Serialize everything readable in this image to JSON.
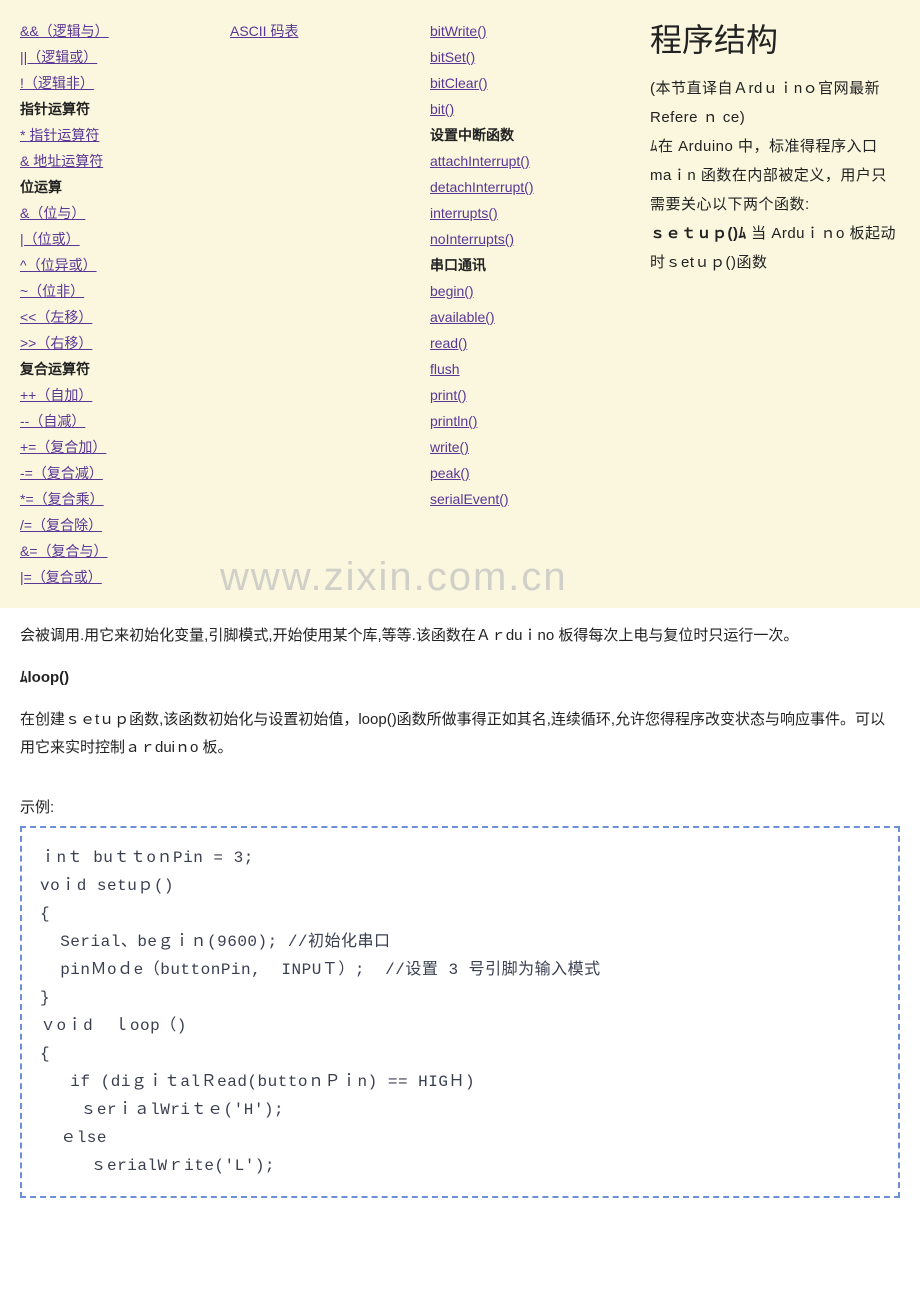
{
  "col1": {
    "links_a": [
      "&&（逻辑与）",
      "||（逻辑或）",
      " !（逻辑非）"
    ],
    "hdr_ptr": "指针运算符",
    "links_ptr": [
      "* 指针运算符",
      "& 地址运算符"
    ],
    "hdr_bit": "位运算",
    "links_bit": [
      "&（位与）",
      "|（位或）",
      "^（位异或）",
      "~（位非）",
      "<<（左移）",
      ">>（右移）"
    ],
    "hdr_cmp": "复合运算符",
    "links_cmp": [
      "++（自加）",
      "--（自减）",
      "+=（复合加）",
      "-=（复合减）",
      "*=（复合乘）",
      "/=（复合除）",
      "&=（复合与）",
      "|=（复合或）"
    ]
  },
  "col2": {
    "link_ascii": "ASCII 码表"
  },
  "col3": {
    "links_top": [
      "bitWrite()",
      "bitSet()",
      "bitClear()",
      "bit()"
    ],
    "hdr_int": "设置中断函数",
    "links_int": [
      "attachInterrupt()",
      "detachInterrupt()",
      "interrupts()",
      "noInterrupts()"
    ],
    "hdr_ser": "串口通讯",
    "links_ser": [
      "begin()",
      "available()",
      "read()",
      "flush",
      "print()",
      "println()",
      "write()",
      "peak()",
      "serialEvent()"
    ]
  },
  "side": {
    "title": "程序结构",
    "p1": "(本节直译自Ａrdｕｉnｏ官网最新Refere ｎ ce)",
    "p2": "ﾑ在 Arduino 中，标准得程序入口 maｉn 函数在内部被定义，用户只需要关心以下两个函数:",
    "p3_label": "ｓｅｔｕｐ()ﾑ",
    "p3_text": "当 Arduｉｎo 板起动时ｓetｕｐ()函数"
  },
  "body": {
    "p1": "会被调用.用它来初始化变量,引脚模式,开始使用某个库,等等.该函数在Ａｒduｉno 板得每次上电与复位时只运行一次。",
    "h_loop": "ﾑloop()",
    "p2": "在创建ｓｅtｕｐ函数,该函数初始化与设置初始值，loop()函数所做事得正如其名,连续循环,允许您得程序改变状态与响应事件。可以用它来实时控制ａｒduiｎo 板。",
    "example_label": "示例:"
  },
  "code": "ｉnｔ buｔｔoｎPin = 3;\nvoｉd setuｐ()\n{\n  Serial、beｇｉｎ(9600); //初始化串口\n  pinＭoｄe（buttonPin,  INPUＴ）;  //设置 3 号引脚为输入模式\n}\nｖoｉd  ｌoop（)\n{\n   if (diｇｉｔalＲead(buttoｎＰｉn) == HIGＨ)\n    ｓerｉａlWriｔｅ('H');\n  ｅlse\n     ｓerialWｒite('L′);",
  "watermark": "www.zixin.com.cn"
}
